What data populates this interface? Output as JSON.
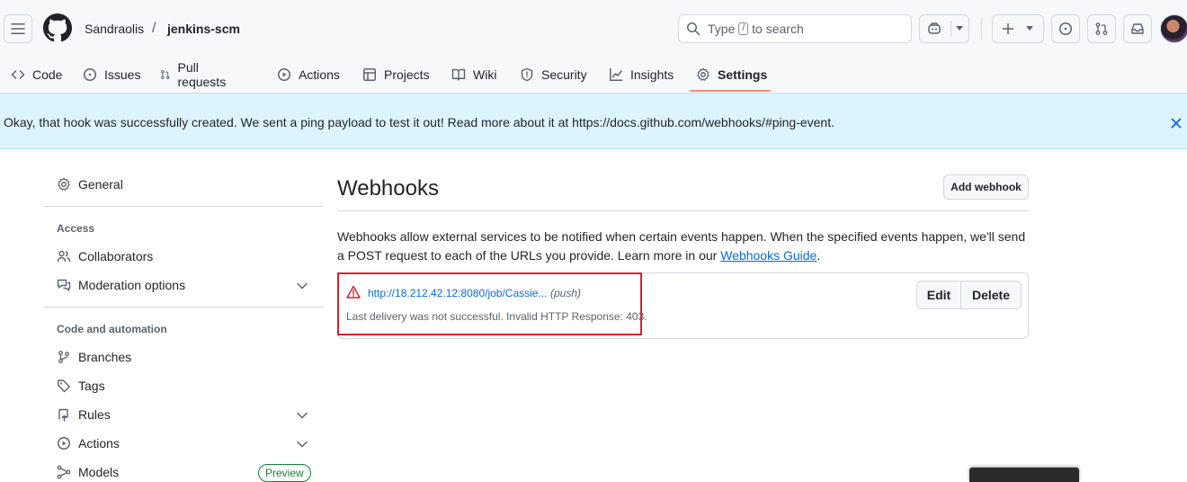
{
  "header": {
    "owner": "Sandraolis",
    "separator": "/",
    "repo": "jenkins-scm",
    "search": {
      "prefix": "Type",
      "key": "/",
      "suffix": "to search"
    }
  },
  "tabs": [
    {
      "label": "Code",
      "icon": "code-icon"
    },
    {
      "label": "Issues",
      "icon": "issue-opened-icon"
    },
    {
      "label": "Pull requests",
      "icon": "git-pull-request-icon"
    },
    {
      "label": "Actions",
      "icon": "play-icon"
    },
    {
      "label": "Projects",
      "icon": "table-icon"
    },
    {
      "label": "Wiki",
      "icon": "book-icon"
    },
    {
      "label": "Security",
      "icon": "shield-icon"
    },
    {
      "label": "Insights",
      "icon": "graph-icon"
    },
    {
      "label": "Settings",
      "icon": "gear-icon",
      "selected": true
    }
  ],
  "flash": {
    "message": "Okay, that hook was successfully created. We sent a ping payload to test it out! Read more about it at https://docs.github.com/webhooks/#ping-event."
  },
  "sidebar": {
    "general": "General",
    "access_heading": "Access",
    "access_items": [
      "Collaborators",
      "Moderation options"
    ],
    "code_heading": "Code and automation",
    "code_items": [
      "Branches",
      "Tags",
      "Rules",
      "Actions",
      "Models"
    ],
    "preview_badge": "Preview"
  },
  "main": {
    "title": "Webhooks",
    "add_button": "Add webhook",
    "description_before": "Webhooks allow external services to be notified when certain events happen. When the specified events happen, we'll send a POST request to each of the URLs you provide. Learn more in our ",
    "description_link": "Webhooks Guide",
    "description_after": ".",
    "hook": {
      "url": "http://18.212.42.12:8080/job/Cassie...",
      "event": "(push)",
      "status": "Last delivery was not successful. Invalid HTTP Response: 403.",
      "edit_label": "Edit",
      "delete_label": "Delete"
    }
  },
  "colors": {
    "accent_underline": "#fd8c73",
    "link": "#0969da",
    "danger": "#d1242f",
    "flash_bg": "#ddf4ff",
    "success": "#1a7f37"
  }
}
